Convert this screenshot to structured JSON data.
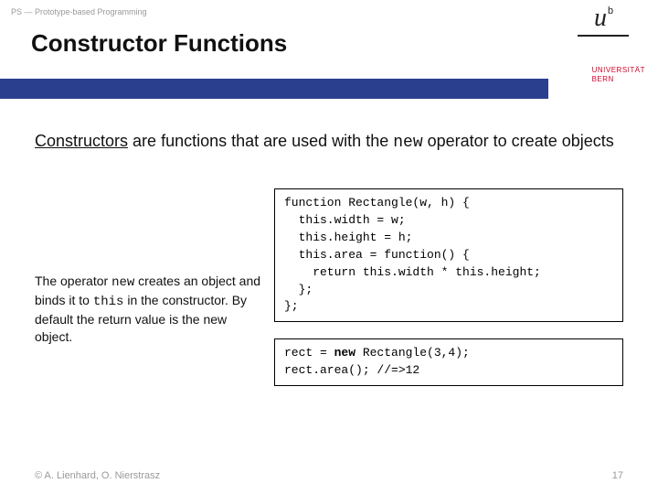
{
  "header": {
    "breadcrumb": "PS — Prototype-based Programming"
  },
  "logo": {
    "u": "u",
    "b": "b",
    "uni1": "UNIVERSITÄT",
    "uni2": "BERN"
  },
  "title": "Constructor Functions",
  "intro": {
    "word_constructors": "Constructors",
    "text1": " are functions that are used with the ",
    "code_new": "new",
    "text2": " operator to create objects"
  },
  "explain": {
    "t1": "The operator ",
    "c1": "new",
    "t2": " creates an object and binds it to ",
    "c2": "this",
    "t3": " in the constructor. By default the return value is the new object."
  },
  "chart_data": {
    "type": "table",
    "code_block_1": "function Rectangle(w, h) {\n  this.width = w;\n  this.height = h;\n  this.area = function() {\n    return this.width * this.height;\n  };\n};",
    "code_block_2_pre": "rect = ",
    "code_block_2_bold": "new",
    "code_block_2_post": " Rectangle(3,4);\nrect.area(); //=>12"
  },
  "footer": {
    "credit": "© A. Lienhard, O. Nierstrasz",
    "page": "17"
  }
}
